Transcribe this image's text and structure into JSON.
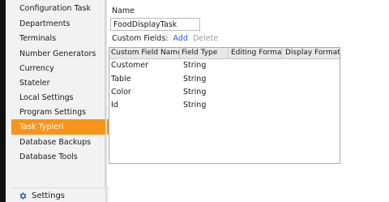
{
  "sidebar": {
    "items": [
      {
        "label": "Configuration Task"
      },
      {
        "label": "Departments"
      },
      {
        "label": "Terminals"
      },
      {
        "label": "Number Generators"
      },
      {
        "label": "Currency"
      },
      {
        "label": "Stateler"
      },
      {
        "label": "Local Settings"
      },
      {
        "label": "Program Settings"
      },
      {
        "label": "Task Typleri",
        "active": true
      },
      {
        "label": "Database Backups"
      },
      {
        "label": "Database Tools"
      }
    ],
    "footer": {
      "label": "Settings",
      "icon": "gear-icon"
    }
  },
  "form": {
    "name_label": "Name",
    "name_value": "FoodDisplayTask",
    "custom_fields_label": "Custom Fields:",
    "add_label": "Add",
    "delete_label": "Delete"
  },
  "grid": {
    "columns": [
      "Custom Field Name",
      "Field Type",
      "Editing Format",
      "Display Format"
    ],
    "rows": [
      [
        "Customer",
        "String",
        "",
        ""
      ],
      [
        "Table",
        "String",
        "",
        ""
      ],
      [
        "Color",
        "String",
        "",
        ""
      ],
      [
        "Id",
        "String",
        "",
        ""
      ]
    ]
  },
  "colors": {
    "accent": "#f7941d",
    "link": "#1a5fd8",
    "disabled_link": "#9a9a9a",
    "gear": "#2b67b8"
  }
}
